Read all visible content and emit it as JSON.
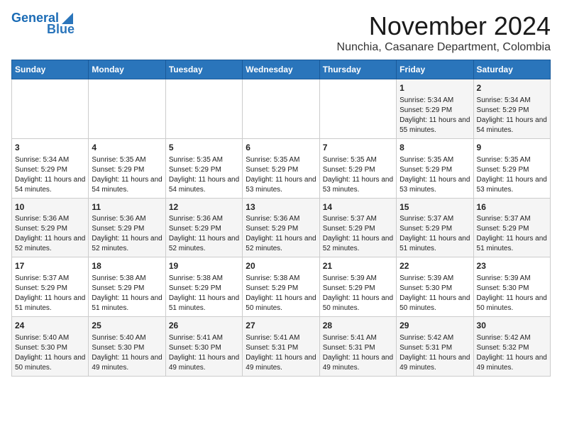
{
  "logo": {
    "line1": "General",
    "line2": "Blue"
  },
  "title": "November 2024",
  "subtitle": "Nunchia, Casanare Department, Colombia",
  "days_of_week": [
    "Sunday",
    "Monday",
    "Tuesday",
    "Wednesday",
    "Thursday",
    "Friday",
    "Saturday"
  ],
  "weeks": [
    [
      {
        "day": "",
        "content": ""
      },
      {
        "day": "",
        "content": ""
      },
      {
        "day": "",
        "content": ""
      },
      {
        "day": "",
        "content": ""
      },
      {
        "day": "",
        "content": ""
      },
      {
        "day": "1",
        "content": "Sunrise: 5:34 AM\nSunset: 5:29 PM\nDaylight: 11 hours and 55 minutes."
      },
      {
        "day": "2",
        "content": "Sunrise: 5:34 AM\nSunset: 5:29 PM\nDaylight: 11 hours and 54 minutes."
      }
    ],
    [
      {
        "day": "3",
        "content": "Sunrise: 5:34 AM\nSunset: 5:29 PM\nDaylight: 11 hours and 54 minutes."
      },
      {
        "day": "4",
        "content": "Sunrise: 5:35 AM\nSunset: 5:29 PM\nDaylight: 11 hours and 54 minutes."
      },
      {
        "day": "5",
        "content": "Sunrise: 5:35 AM\nSunset: 5:29 PM\nDaylight: 11 hours and 54 minutes."
      },
      {
        "day": "6",
        "content": "Sunrise: 5:35 AM\nSunset: 5:29 PM\nDaylight: 11 hours and 53 minutes."
      },
      {
        "day": "7",
        "content": "Sunrise: 5:35 AM\nSunset: 5:29 PM\nDaylight: 11 hours and 53 minutes."
      },
      {
        "day": "8",
        "content": "Sunrise: 5:35 AM\nSunset: 5:29 PM\nDaylight: 11 hours and 53 minutes."
      },
      {
        "day": "9",
        "content": "Sunrise: 5:35 AM\nSunset: 5:29 PM\nDaylight: 11 hours and 53 minutes."
      }
    ],
    [
      {
        "day": "10",
        "content": "Sunrise: 5:36 AM\nSunset: 5:29 PM\nDaylight: 11 hours and 52 minutes."
      },
      {
        "day": "11",
        "content": "Sunrise: 5:36 AM\nSunset: 5:29 PM\nDaylight: 11 hours and 52 minutes."
      },
      {
        "day": "12",
        "content": "Sunrise: 5:36 AM\nSunset: 5:29 PM\nDaylight: 11 hours and 52 minutes."
      },
      {
        "day": "13",
        "content": "Sunrise: 5:36 AM\nSunset: 5:29 PM\nDaylight: 11 hours and 52 minutes."
      },
      {
        "day": "14",
        "content": "Sunrise: 5:37 AM\nSunset: 5:29 PM\nDaylight: 11 hours and 52 minutes."
      },
      {
        "day": "15",
        "content": "Sunrise: 5:37 AM\nSunset: 5:29 PM\nDaylight: 11 hours and 51 minutes."
      },
      {
        "day": "16",
        "content": "Sunrise: 5:37 AM\nSunset: 5:29 PM\nDaylight: 11 hours and 51 minutes."
      }
    ],
    [
      {
        "day": "17",
        "content": "Sunrise: 5:37 AM\nSunset: 5:29 PM\nDaylight: 11 hours and 51 minutes."
      },
      {
        "day": "18",
        "content": "Sunrise: 5:38 AM\nSunset: 5:29 PM\nDaylight: 11 hours and 51 minutes."
      },
      {
        "day": "19",
        "content": "Sunrise: 5:38 AM\nSunset: 5:29 PM\nDaylight: 11 hours and 51 minutes."
      },
      {
        "day": "20",
        "content": "Sunrise: 5:38 AM\nSunset: 5:29 PM\nDaylight: 11 hours and 50 minutes."
      },
      {
        "day": "21",
        "content": "Sunrise: 5:39 AM\nSunset: 5:29 PM\nDaylight: 11 hours and 50 minutes."
      },
      {
        "day": "22",
        "content": "Sunrise: 5:39 AM\nSunset: 5:30 PM\nDaylight: 11 hours and 50 minutes."
      },
      {
        "day": "23",
        "content": "Sunrise: 5:39 AM\nSunset: 5:30 PM\nDaylight: 11 hours and 50 minutes."
      }
    ],
    [
      {
        "day": "24",
        "content": "Sunrise: 5:40 AM\nSunset: 5:30 PM\nDaylight: 11 hours and 50 minutes."
      },
      {
        "day": "25",
        "content": "Sunrise: 5:40 AM\nSunset: 5:30 PM\nDaylight: 11 hours and 49 minutes."
      },
      {
        "day": "26",
        "content": "Sunrise: 5:41 AM\nSunset: 5:30 PM\nDaylight: 11 hours and 49 minutes."
      },
      {
        "day": "27",
        "content": "Sunrise: 5:41 AM\nSunset: 5:31 PM\nDaylight: 11 hours and 49 minutes."
      },
      {
        "day": "28",
        "content": "Sunrise: 5:41 AM\nSunset: 5:31 PM\nDaylight: 11 hours and 49 minutes."
      },
      {
        "day": "29",
        "content": "Sunrise: 5:42 AM\nSunset: 5:31 PM\nDaylight: 11 hours and 49 minutes."
      },
      {
        "day": "30",
        "content": "Sunrise: 5:42 AM\nSunset: 5:32 PM\nDaylight: 11 hours and 49 minutes."
      }
    ]
  ]
}
